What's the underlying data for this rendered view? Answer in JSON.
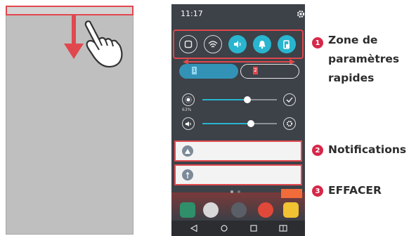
{
  "status_bar": {
    "time": "11:17"
  },
  "quick_settings": {
    "buttons": [
      {
        "icon": "screen-capture-icon",
        "active": false
      },
      {
        "icon": "wifi-icon",
        "active": false
      },
      {
        "icon": "sound-icon",
        "active": true
      },
      {
        "icon": "notification-bell-icon",
        "active": true
      },
      {
        "icon": "rotate-screen-icon",
        "active": true
      }
    ]
  },
  "sim_cards": [
    {
      "label": "1",
      "active": true
    },
    {
      "label": "2",
      "active": false
    }
  ],
  "brightness": {
    "percent_label": "63%",
    "level": 0.6
  },
  "volume": {
    "level": 0.65
  },
  "callouts": [
    {
      "number": "1",
      "text": "Zone de\nparamètres\nrapides"
    },
    {
      "number": "2",
      "text": "Notifications"
    },
    {
      "number": "3",
      "text": "EFFACER"
    }
  ],
  "colors": {
    "accent": "#29b5cf",
    "highlight": "#e0484e",
    "badge": "#d6284a",
    "panel": "#3d4148"
  }
}
